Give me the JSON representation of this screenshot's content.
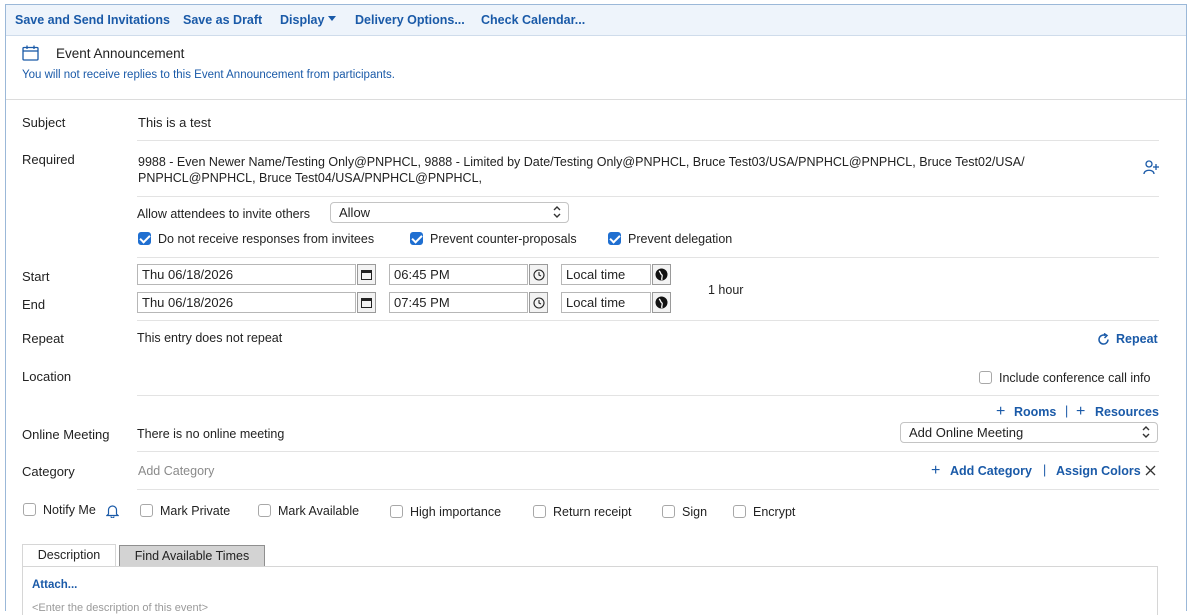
{
  "toolbar": {
    "save_send": "Save and Send Invitations",
    "save_draft": "Save as Draft",
    "display": "Display",
    "delivery": "Delivery Options...",
    "check_calendar": "Check Calendar..."
  },
  "header": {
    "title": "Event Announcement",
    "notice": "You will not receive replies to this Event Announcement from participants."
  },
  "subject": {
    "label": "Subject",
    "value": "This is a test"
  },
  "required": {
    "label": "Required",
    "line1": "9988 - Even Newer Name/Testing Only@PNPHCL, 9888 - Limited by Date/Testing Only@PNPHCL, Bruce Test03/USA/PNPHCL@PNPHCL, Bruce Test02/USA/",
    "line2": "PNPHCL@PNPHCL, Bruce Test04/USA/PNPHCL@PNPHCL,"
  },
  "invite": {
    "label": "Allow attendees to invite others",
    "value": "Allow"
  },
  "options": {
    "no_responses": "Do not receive responses from invitees",
    "prevent_counter": "Prevent counter-proposals",
    "prevent_delegation": "Prevent delegation"
  },
  "start": {
    "label": "Start",
    "date": "Thu 06/18/2026",
    "time": "06:45 PM",
    "zone": "Local time"
  },
  "end": {
    "label": "End",
    "date": "Thu 06/18/2026",
    "time": "07:45 PM",
    "zone": "Local time"
  },
  "duration": "1 hour",
  "repeat": {
    "label": "Repeat",
    "value": "This entry does not repeat",
    "link": "Repeat"
  },
  "location": {
    "label": "Location",
    "conference": "Include conference call info",
    "rooms": "Rooms",
    "divider": "|",
    "resources": "Resources"
  },
  "online": {
    "label": "Online Meeting",
    "value": "There is no online meeting",
    "select": "Add Online Meeting"
  },
  "category": {
    "label": "Category",
    "placeholder": "Add Category",
    "add": "Add Category",
    "divider": "|",
    "assign": "Assign Colors"
  },
  "flags": {
    "notify_me": "Notify Me",
    "mark_private": "Mark Private",
    "mark_available": "Mark Available",
    "high_importance": "High importance",
    "return_receipt": "Return receipt",
    "sign": "Sign",
    "encrypt": "Encrypt"
  },
  "tabs": {
    "description": "Description",
    "find_times": "Find Available Times"
  },
  "body": {
    "attach": "Attach...",
    "placeholder": "<Enter the description of this event>"
  },
  "colors": {
    "accent": "#1a5aa8",
    "checkbox": "#1f6fd1"
  }
}
